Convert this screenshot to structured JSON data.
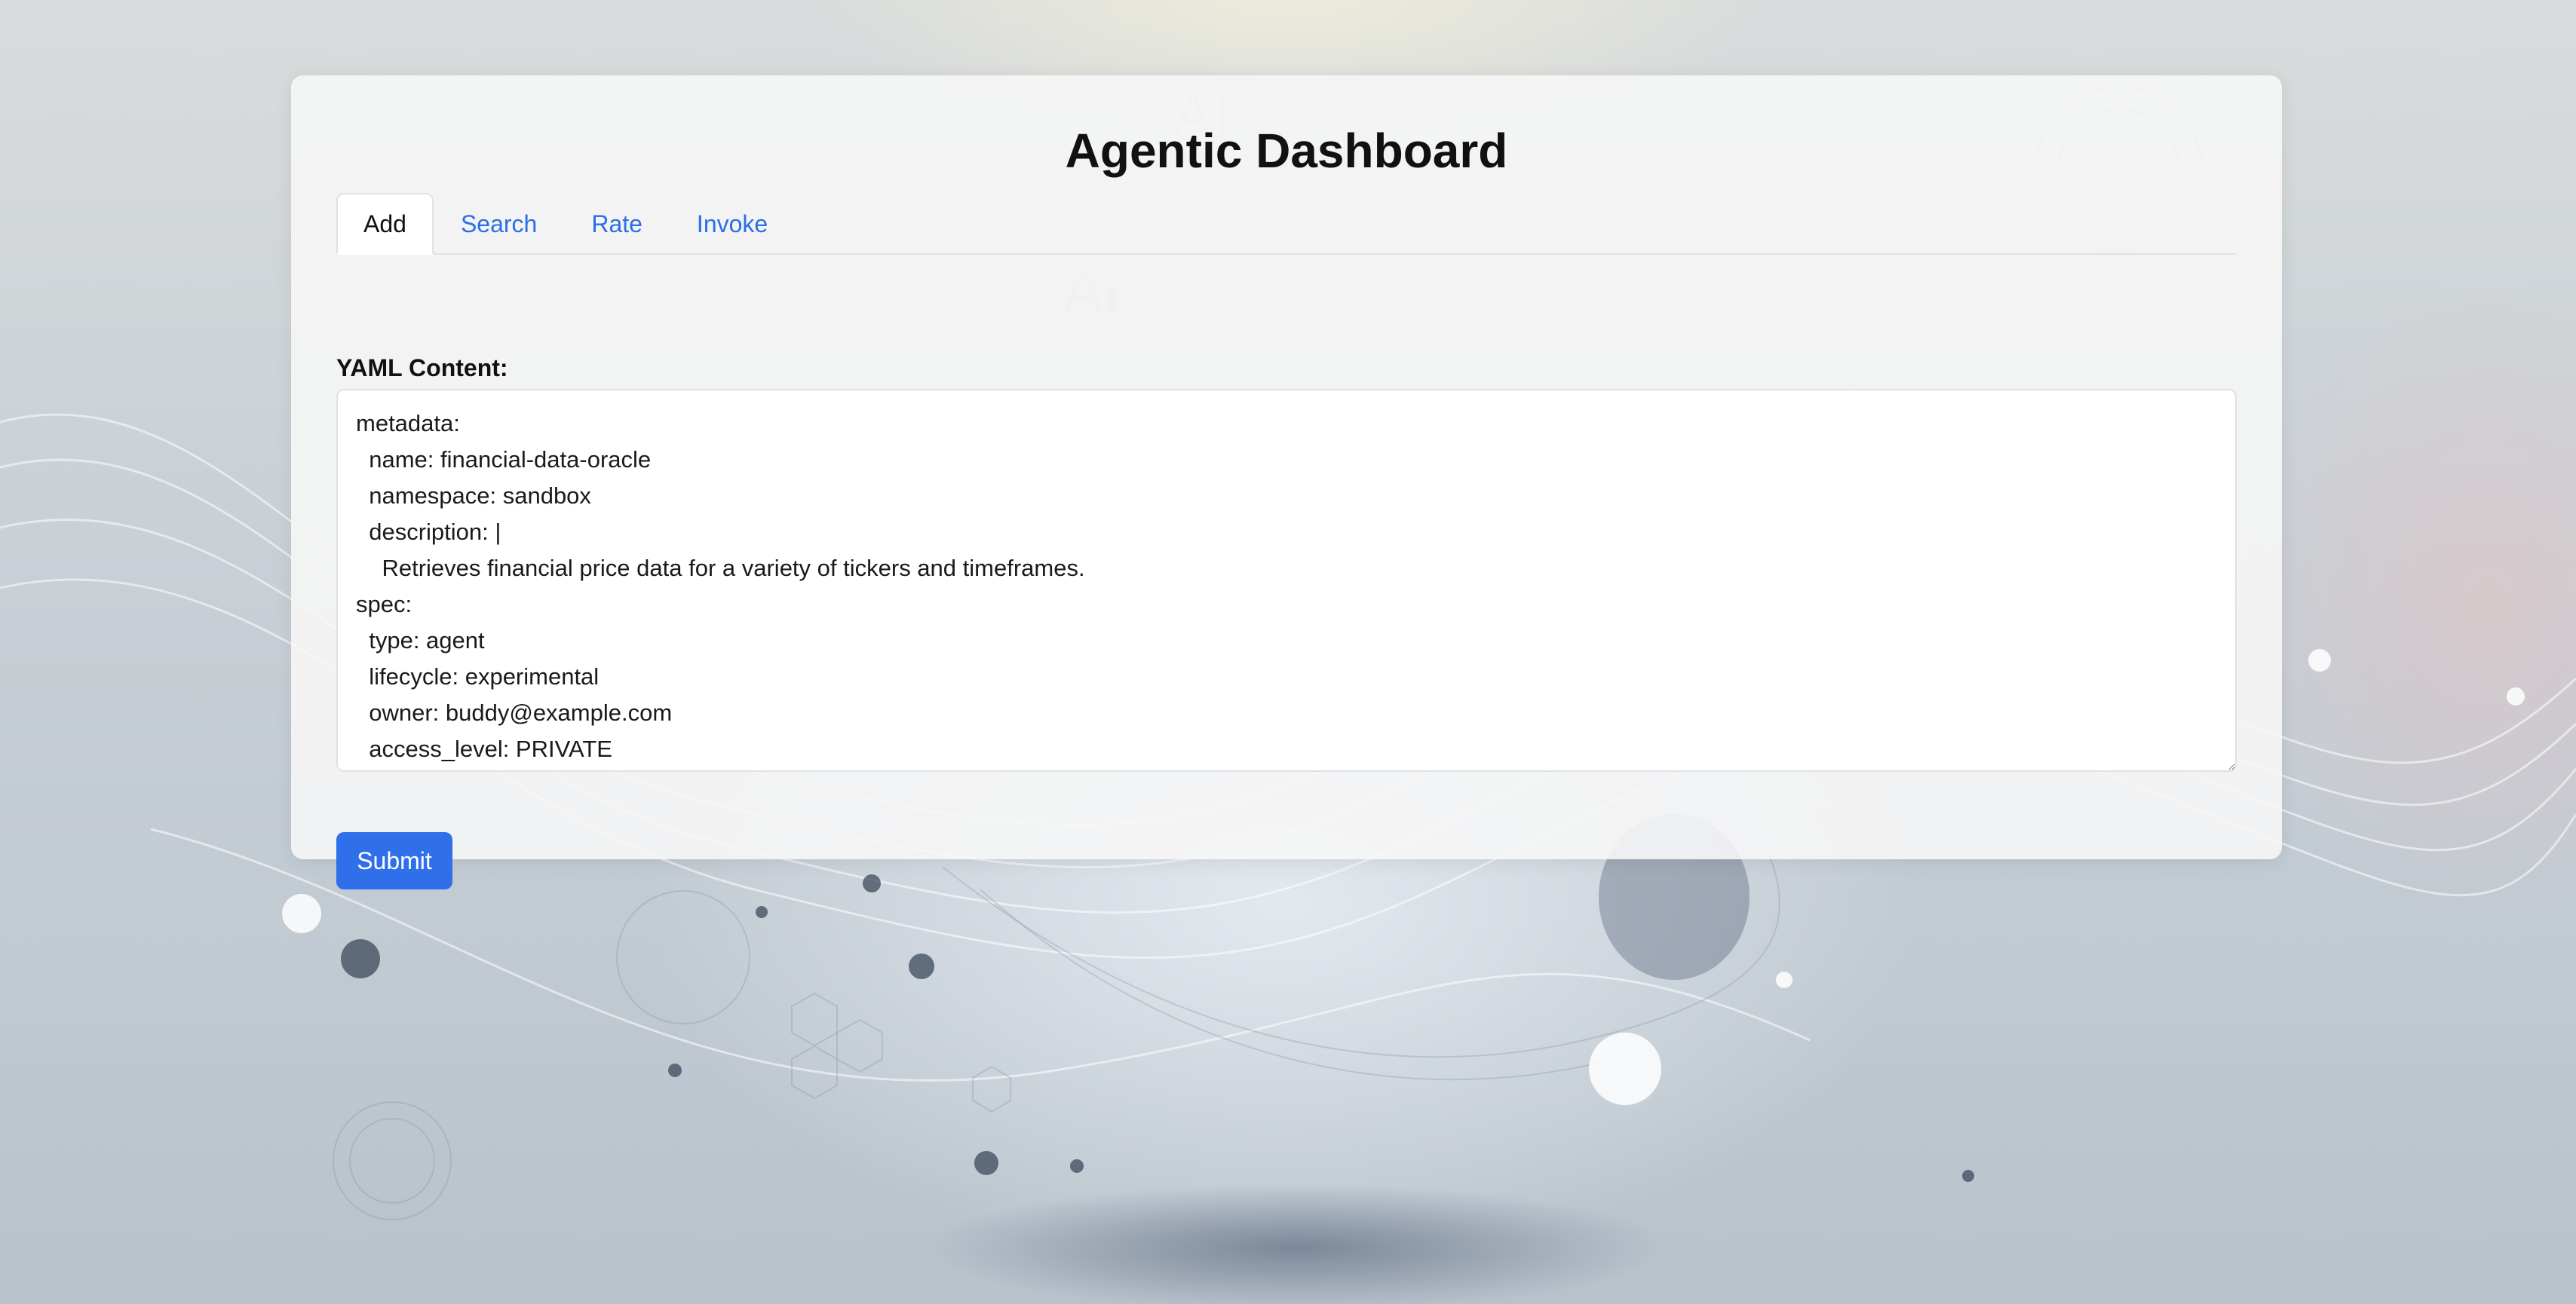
{
  "app": {
    "title": "Agentic Dashboard"
  },
  "tabs": [
    {
      "label": "Add",
      "active": true
    },
    {
      "label": "Search",
      "active": false
    },
    {
      "label": "Rate",
      "active": false
    },
    {
      "label": "Invoke",
      "active": false
    }
  ],
  "form": {
    "yaml_label": "YAML Content:",
    "yaml_value": "metadata:\n  name: financial-data-oracle\n  namespace: sandbox\n  description: |\n    Retrieves financial price data for a variety of tickers and timeframes.\nspec:\n  type: agent\n  lifecycle: experimental\n  owner: buddy@example.com\n  access_level: PRIVATE",
    "submit_label": "Submit"
  },
  "background": {
    "watermark_text": "AI"
  },
  "colors": {
    "accent": "#2f6fea",
    "tab_link": "#2a6ee8",
    "card_bg": "#f6f6f6"
  }
}
